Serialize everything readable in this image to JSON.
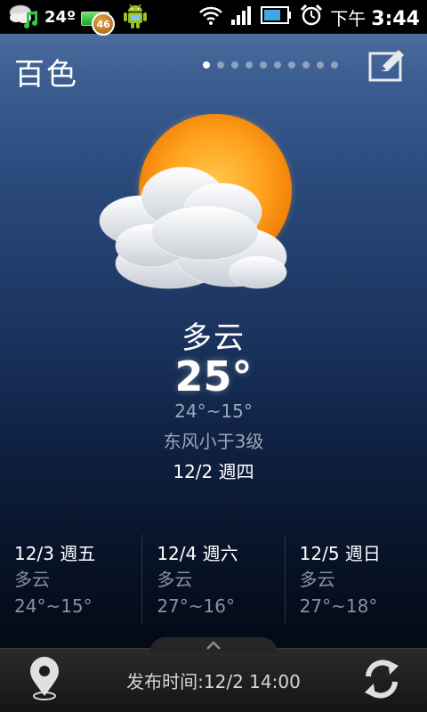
{
  "status_bar": {
    "temperature": "24º",
    "battery_badge": "46",
    "time_period": "下午",
    "time": "3:44",
    "icons": [
      "weather-icon",
      "music-icon",
      "battery-icon",
      "android-icon",
      "wifi-icon",
      "signal-icon",
      "battery-level-icon",
      "alarm-icon"
    ]
  },
  "header": {
    "city": "百色",
    "page_count": 10,
    "active_page": 1,
    "edit_icon": "edit-icon"
  },
  "current": {
    "icon": "partly-cloudy-icon",
    "condition": "多云",
    "temperature": "25°",
    "range": "24°~15°",
    "wind": "东风小于3级",
    "date": "12/2 週四"
  },
  "forecast": [
    {
      "date": "12/3 週五",
      "condition": "多云",
      "range": "24°~15°"
    },
    {
      "date": "12/4 週六",
      "condition": "多云",
      "range": "27°~16°"
    },
    {
      "date": "12/5 週日",
      "condition": "多云",
      "range": "27°~18°"
    }
  ],
  "bottom_bar": {
    "publish_time": "发布时间:12/2 14:00",
    "location_icon": "location-pin-icon",
    "refresh_icon": "refresh-icon",
    "expand_icon": "chevron-up-icon"
  },
  "colors": {
    "accent_sun": "#ffa01a",
    "text_primary": "#ffffff",
    "text_secondary": "#9aa7b8"
  }
}
